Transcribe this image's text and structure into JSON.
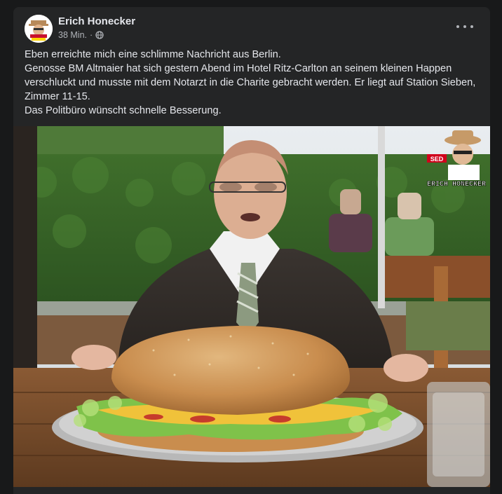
{
  "post": {
    "author": "Erich Honecker",
    "time": "38 Min.",
    "separator": "·",
    "privacy_icon": "globe-icon",
    "more_icon": "more-options-icon",
    "text_lines": [
      "Eben erreichte mich eine schlimme Nachricht aus Berlin.",
      "Genosse BM Altmaier hat sich gestern Abend im Hotel Ritz-Carlton an seinem kleinen Happen verschluckt und musste mit dem Notarzt in die Charite gebracht werden. Er liegt auf Station Sieben, Zimmer 11-15.",
      "Das Politbüro wünscht schnelle Besserung."
    ]
  },
  "image": {
    "watermark_badge": "SED",
    "watermark_name": "ERICH HONECKER"
  },
  "colors": {
    "page_bg": "#18191a",
    "card_bg": "#242526",
    "primary_text": "#e4e6eb",
    "secondary_text": "#b0b3b8"
  }
}
